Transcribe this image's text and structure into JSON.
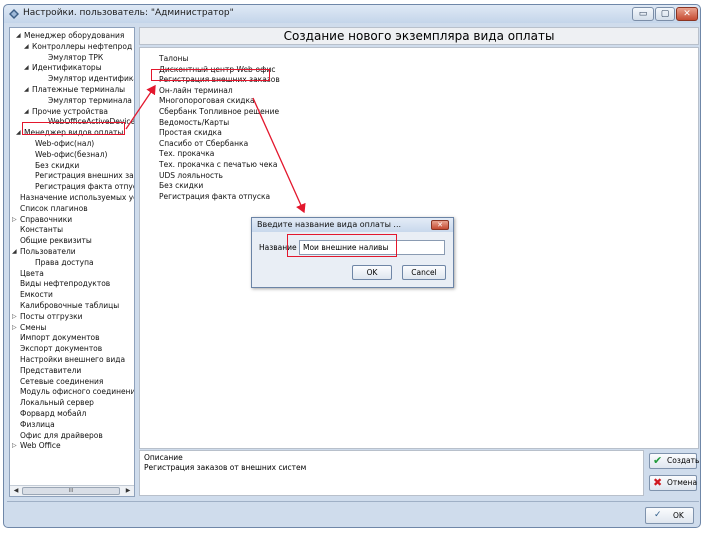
{
  "window": {
    "title": "Настройки. пользователь: \"Администратор\"",
    "minimize_glyph": "▭",
    "maximize_glyph": "▢",
    "close_glyph": "✕"
  },
  "header": {
    "title": "Создание нового экземпляра вида оплаты"
  },
  "tree": {
    "items": [
      {
        "label": "Менеджер оборудования",
        "expanded": true
      },
      {
        "label": "Контроллеры нефтепрод",
        "expanded": true
      },
      {
        "label": "Эмулятор ТРК"
      },
      {
        "label": "Идентификаторы",
        "expanded": true
      },
      {
        "label": "Эмулятор идентифика"
      },
      {
        "label": "Платежные терминалы",
        "expanded": true
      },
      {
        "label": "Эмулятор терминала"
      },
      {
        "label": "Прочие устройства",
        "expanded": true
      },
      {
        "label": "WebOfficeActiveDevice"
      },
      {
        "label": "Менеджер видов оплаты",
        "expanded": true
      },
      {
        "label": "Web-офис(нал)"
      },
      {
        "label": "Web-офис(безнал)"
      },
      {
        "label": "Без скидки"
      },
      {
        "label": "Регистрация внешних зак"
      },
      {
        "label": "Регистрация факта отпуск"
      },
      {
        "label": "Назначение используемых ус"
      },
      {
        "label": "Список плагинов"
      },
      {
        "label": "Справочники",
        "collapsed": true
      },
      {
        "label": "Константы"
      },
      {
        "label": "Общие реквизиты"
      },
      {
        "label": "Пользователи",
        "expanded": true
      },
      {
        "label": "Права доступа"
      },
      {
        "label": "Цвета"
      },
      {
        "label": "Виды нефтепродуктов"
      },
      {
        "label": "Емкости"
      },
      {
        "label": "Калибровочные таблицы"
      },
      {
        "label": "Посты отгрузки",
        "collapsed": true
      },
      {
        "label": "Смены",
        "collapsed": true
      },
      {
        "label": "Импорт документов"
      },
      {
        "label": "Экспорт документов"
      },
      {
        "label": "Настройки внешнего вида"
      },
      {
        "label": "Представители"
      },
      {
        "label": "Сетевые соединения"
      },
      {
        "label": "Модуль офисного соединени"
      },
      {
        "label": "Локальный сервер"
      },
      {
        "label": "Форвард мобайл"
      },
      {
        "label": "Физлица"
      },
      {
        "label": "Офис для драйверов"
      },
      {
        "label": "Web Office",
        "collapsed": true
      }
    ],
    "scroll_left": "◀",
    "scroll_right": "▶",
    "scroll_thumb": "III"
  },
  "payment_types": [
    "Талоны",
    "Дисконтный центр Web-офис",
    "Регистрация внешних заказов",
    "Он-лайн терминал",
    "Многопороговая скидка",
    "Сбербанк Топливное решение",
    "Ведомость/Карты",
    "Простая скидка",
    "Спасибо от Сбербанка",
    "Тех. прокачка",
    "Тех. прокачка с печатью чека",
    "UDS лояльность",
    "Без скидки",
    "Регистрация факта отпуска"
  ],
  "description": {
    "label": "Описание",
    "text": "Регистрация заказов от внешних систем"
  },
  "buttons": {
    "create": "Создать",
    "cancel": "Отмена",
    "ok": "OK"
  },
  "dialog": {
    "title": "Введите название вида оплаты ...",
    "field_label": "Название",
    "field_value": "Мои внешние наливы",
    "ok": "OK",
    "cancel": "Cancel"
  },
  "colors": {
    "highlight": "#e3172d",
    "window_frame": "#cfdcec"
  }
}
